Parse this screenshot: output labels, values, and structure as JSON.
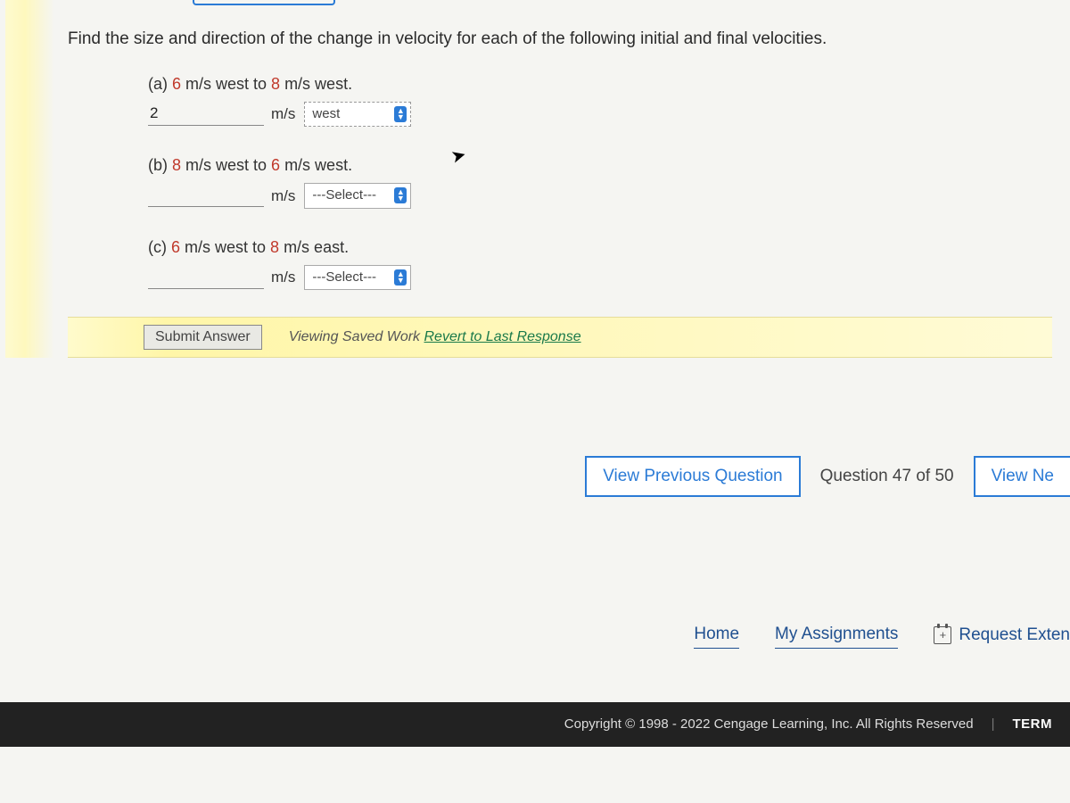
{
  "prompt": "Find the size and direction of the change in velocity for each of the following initial and final velocities.",
  "parts": {
    "a": {
      "label_pre": "(a) ",
      "n1": "6",
      "mid": " m/s west to ",
      "n2": "8",
      "post": " m/s west.",
      "value": "2",
      "unit": "m/s",
      "select": "west"
    },
    "b": {
      "label_pre": "(b) ",
      "n1": "8",
      "mid": " m/s west to ",
      "n2": "6",
      "post": " m/s west.",
      "value": "",
      "unit": "m/s",
      "select": "---Select---"
    },
    "c": {
      "label_pre": "(c) ",
      "n1": "6",
      "mid": " m/s west to ",
      "n2": "8",
      "post": " m/s east.",
      "value": "",
      "unit": "m/s",
      "select": "---Select---"
    }
  },
  "submit": {
    "button": "Submit Answer",
    "saved_prefix": "Viewing Saved Work ",
    "revert": "Revert to Last Response"
  },
  "nav": {
    "prev": "View Previous Question",
    "count": "Question 47 of 50",
    "next": "View Ne"
  },
  "links": {
    "home": "Home",
    "assignments": "My Assignments",
    "extension": "Request Exten"
  },
  "footer": {
    "copyright": "Copyright © 1998 - 2022 Cengage Learning, Inc. All Rights Reserved",
    "terms": "TERM"
  }
}
